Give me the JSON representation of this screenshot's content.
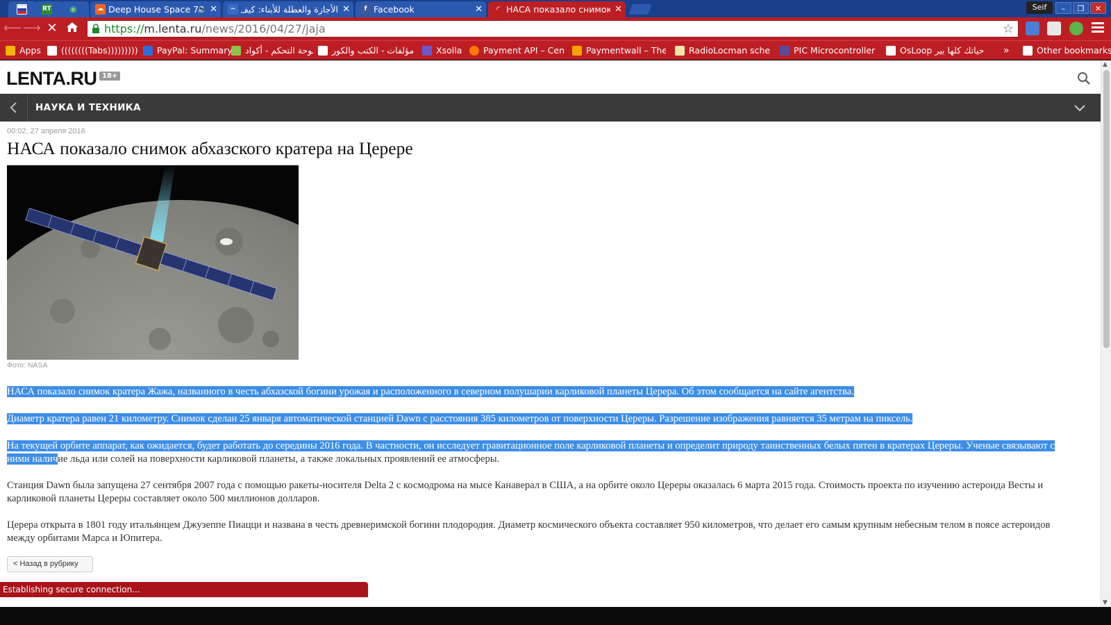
{
  "browser": {
    "tabs": [
      {
        "title": "",
        "favicon": "flag-icon",
        "color": "#d8d8f0"
      },
      {
        "title": "",
        "favicon": "rt-icon",
        "color": "#2f8a2f"
      },
      {
        "title": "",
        "favicon": "wifi-icon",
        "color": "#3aa43a"
      },
      {
        "title": "Deep House Space 78",
        "favicon": "soundcloud-icon",
        "color": "#f2661f",
        "audio": true
      },
      {
        "title": "الأجازة والعطلة للأبناء: كيف",
        "favicon": "site-icon",
        "color": "#3c6bc4"
      },
      {
        "title": "Facebook",
        "favicon": "facebook-icon",
        "color": "#3b5998"
      },
      {
        "title": "НАСА показало снимок",
        "favicon": "lenta-icon",
        "color": "#bd1e24",
        "active": true
      }
    ],
    "user": "Seif",
    "url": {
      "scheme": "https://",
      "host": "m.lenta.ru",
      "path": "/news/2016/04/27/jaja"
    },
    "bookmarks": [
      {
        "label": "Apps",
        "icon": "apps-grid-icon",
        "color": "#f4b400"
      },
      {
        "label": "((((((((Tabs)))))))))",
        "icon": "folder-icon",
        "color": "#ffffff"
      },
      {
        "label": "PayPal: Summary",
        "icon": "paypal-icon",
        "color": "#2a6fdb"
      },
      {
        "label": "لوحة التحكم - أكواد",
        "icon": "site-icon",
        "color": "#8bc34a",
        "rtl": true
      },
      {
        "label": "مؤلفات - الكتب والكور",
        "icon": "speaker-icon",
        "color": "#ffffff",
        "rtl": true
      },
      {
        "label": "Xsolla",
        "icon": "xsolla-icon",
        "color": "#6a5acd"
      },
      {
        "label": "Payment API – Centi",
        "icon": "site-icon",
        "color": "#ff7a00"
      },
      {
        "label": "Paymentwall – The e",
        "icon": "paymentwall-icon",
        "color": "#f4a300"
      },
      {
        "label": "RadioLocman schem",
        "icon": "rl-icon",
        "color": "#f5e6a8"
      },
      {
        "label": "PIC Microcontroller F",
        "icon": "pic-icon",
        "color": "#5b4b9e"
      },
      {
        "label": "OsLoop حياتك كلها بير",
        "icon": "osloop-icon",
        "color": "#ffffff"
      }
    ],
    "other_bookmarks": "Other bookmarks",
    "status": "Establishing secure connection..."
  },
  "page": {
    "logo": "LENTA.RU",
    "age_rating": "18+",
    "rubric": "НАУКА И ТЕХНИКА",
    "date": "00:02, 27 апреля 2016",
    "title": "НАСА показало снимок абхазского кратера на Церере",
    "photo_caption": "Фото: NASA",
    "paragraphs": {
      "p1": "НАСА показало снимок кратера Жажа, названного в честь абхазской богини урожая и расположенного в северном полушарии карликовой планеты Церера. Об этом сообщается на сайте агентства.",
      "p2": "Диаметр кратера равен 21 километру. Снимок сделан 25 января автоматической станцией Dawn с расстояния 385 километров от поверхности Цереры. Разрешение изображения равняется 35 метрам на пиксель.",
      "p3_selected": "На текущей орбите аппарат, как ожидается, будет работать до середины 2016 года. В частности, он исследует гравитационное поле карликовой планеты и определит природу таинственных белых пятен в кратерах Цереры. Ученые связывают с ними налич",
      "p3_rest": "ие льда или солей на поверхности карликовой планеты, а также локальных проявлений ее атмосферы.",
      "p4": "Станция Dawn была запущена 27 сентября 2007 года с помощью ракеты-носителя Delta 2 с космодрома на мысе Канаверал в США, а на орбите около Цереры оказалась 6 марта 2015 года. Стоимость проекта по изучению астероида Весты и карликовой планеты Цереры составляет около 500 миллионов долларов.",
      "p5": "Церера открыта в 1801 году итальянцем Джузеппе Пиацци и названа в честь древнеримской богини плодородия. Диаметр космического объекта составляет 950 километров, что делает его самым крупным небесным телом в поясе астероидов между орбитами Марса и Юпитера."
    },
    "back_button": "< Назад в рубрику"
  }
}
